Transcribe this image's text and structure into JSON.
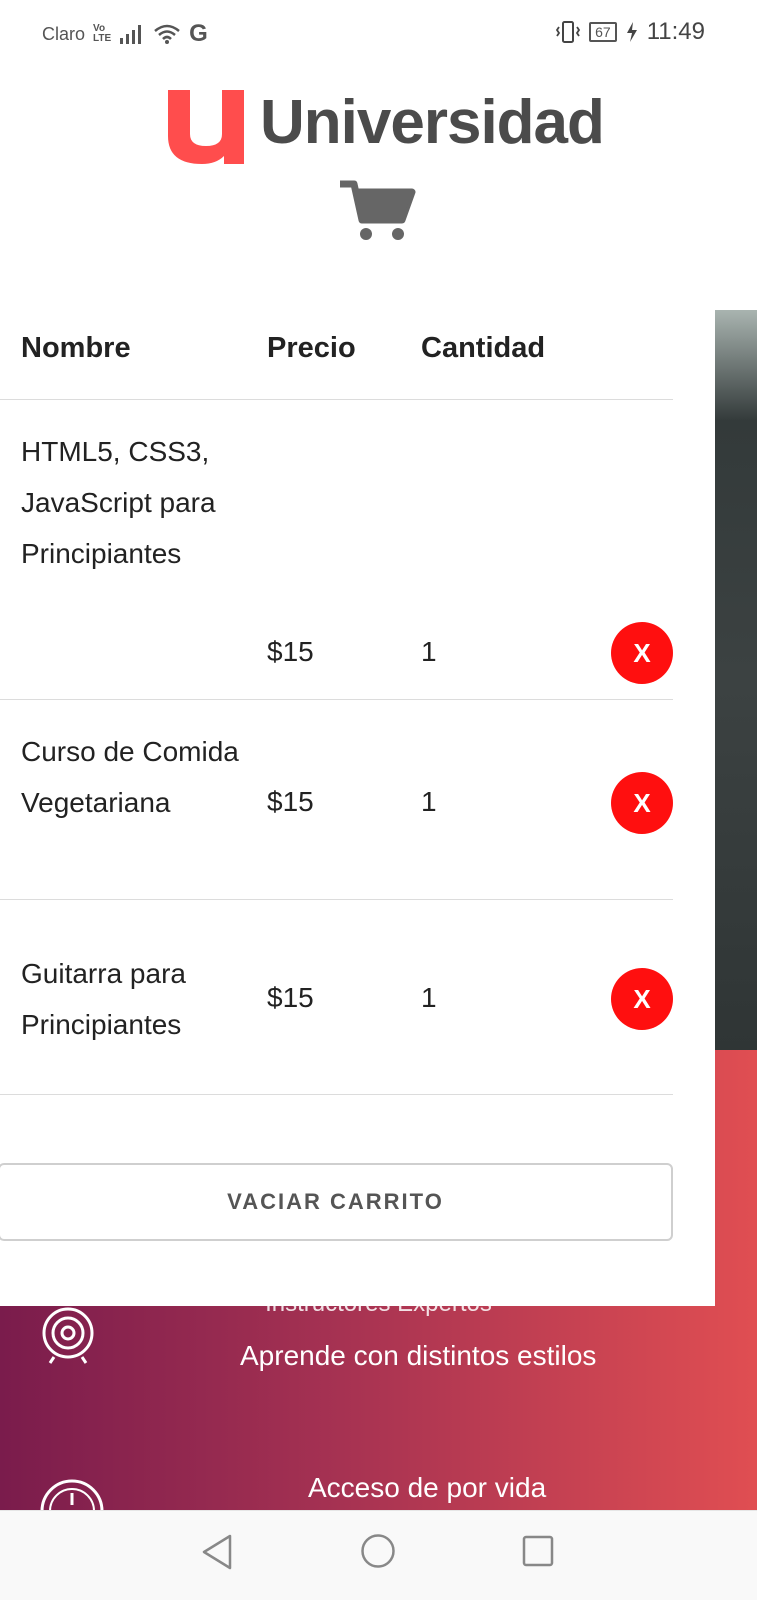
{
  "status_bar": {
    "carrier": "Claro",
    "volte_top": "Vo",
    "volte_bottom": "LTE",
    "network": "G",
    "battery": "67",
    "time": "11:49"
  },
  "header": {
    "logo_letter": "U",
    "logo_text": "Universidad",
    "logo_color": "#ff4d4d"
  },
  "cart": {
    "columns": {
      "name": "Nombre",
      "price": "Precio",
      "quantity": "Cantidad"
    },
    "items": [
      {
        "name": "HTML5, CSS3, JavaScript para Principiantes",
        "price": "$15",
        "quantity": "1",
        "remove_label": "X"
      },
      {
        "name": "Curso de Comida Vegetariana",
        "price": "$15",
        "quantity": "1",
        "remove_label": "X"
      },
      {
        "name": "Guitarra para Principiantes",
        "price": "$15",
        "quantity": "1",
        "remove_label": "X"
      }
    ],
    "empty_button": "VACIAR CARRITO",
    "remove_color": "#ff0f0f"
  },
  "background": {
    "line_partial": "Instructores Expertos",
    "line_styles": "Aprende con distintos estilos",
    "line_access": "Acceso de por vida"
  }
}
